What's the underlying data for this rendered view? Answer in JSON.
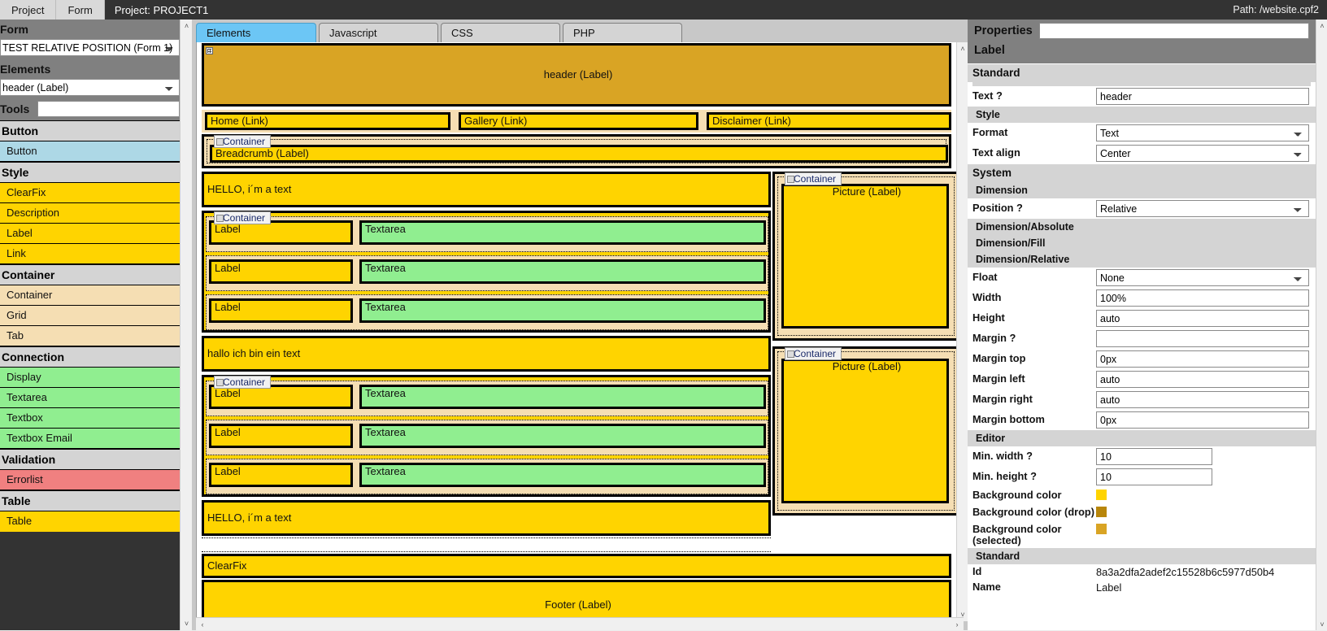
{
  "topbar": {
    "menu": [
      {
        "label": "Project",
        "active": false
      },
      {
        "label": "Form",
        "active": false
      }
    ],
    "project_tab": "Project: PROJECT1",
    "path": "Path: /website.cpf2"
  },
  "sidebar": {
    "form_heading": "Form",
    "form_select_value": "TEST RELATIVE POSITION (Form 1)",
    "elements_heading": "Elements",
    "elements_select_value": "header (Label)",
    "tools_heading": "Tools",
    "tools_input_value": "",
    "groups": [
      {
        "title": "Button",
        "color": "#add8e6",
        "items": [
          {
            "label": "Button"
          }
        ]
      },
      {
        "title": "Style",
        "color": "#ffd400",
        "items": [
          {
            "label": "ClearFix"
          },
          {
            "label": "Description"
          },
          {
            "label": "Label"
          },
          {
            "label": "Link"
          }
        ]
      },
      {
        "title": "Container",
        "color": "#f5deb3",
        "items": [
          {
            "label": "Container"
          },
          {
            "label": "Grid"
          },
          {
            "label": "Tab"
          }
        ]
      },
      {
        "title": "Connection",
        "color": "#90ee90",
        "items": [
          {
            "label": "Display"
          },
          {
            "label": "Textarea"
          },
          {
            "label": "Textbox"
          },
          {
            "label": "Textbox Email"
          }
        ]
      },
      {
        "title": "Validation",
        "color": "#f08080",
        "items": [
          {
            "label": "Errorlist"
          }
        ]
      },
      {
        "title": "Table",
        "color": "#ffd400",
        "items": [
          {
            "label": "Table"
          }
        ]
      }
    ]
  },
  "center": {
    "tabs": [
      {
        "label": "Elements",
        "selected": true
      },
      {
        "label": "Javascript",
        "selected": false
      },
      {
        "label": "CSS",
        "selected": false
      },
      {
        "label": "PHP",
        "selected": false
      }
    ],
    "canvas": {
      "header_label": "header (Label)",
      "nav_links": [
        "Home (Link)",
        "Gallery (Link)",
        "Disclaimer (Link)"
      ],
      "breadcrumb_container_tag": "Container",
      "breadcrumb_label": "Breadcrumb (Label)",
      "text_block_1": "HELLO, i´m a text",
      "form_container_tag": "Container",
      "rows_group_1": [
        {
          "label": "Label",
          "textarea": "Textarea"
        },
        {
          "label": "Label",
          "textarea": "Textarea"
        },
        {
          "label": "Label",
          "textarea": "Textarea"
        }
      ],
      "text_block_2": "hallo ich bin ein text",
      "rows_group_2": [
        {
          "label": "Label",
          "textarea": "Textarea"
        },
        {
          "label": "Label",
          "textarea": "Textarea"
        },
        {
          "label": "Label",
          "textarea": "Textarea"
        }
      ],
      "text_block_3": "HELLO, i´m a text",
      "clearfix_label": "ClearFix",
      "footer_label": "Footer (Label)",
      "picture_container_tag": "Container",
      "picture_label": "Picture (Label)",
      "picture_container_tag_2": "Container",
      "picture_label_2": "Picture (Label)"
    }
  },
  "properties": {
    "title": "Properties",
    "search_value": "",
    "element_type": "Label",
    "sections": {
      "standard_title": "Standard",
      "text_key": "Text",
      "text_value": "header",
      "style_title": "Style",
      "format_key": "Format",
      "format_value": "Text",
      "text_align_key": "Text align",
      "text_align_value": "Center",
      "system_title": "System",
      "dimension_title": "Dimension",
      "position_key": "Position",
      "position_value": "Relative",
      "dim_absolute_title": "Dimension/Absolute",
      "dim_fill_title": "Dimension/Fill",
      "dim_relative_title": "Dimension/Relative",
      "float_key": "Float",
      "float_value": "None",
      "width_key": "Width",
      "width_value": "100%",
      "height_key": "Height",
      "height_value": "auto",
      "margin_key": "Margin",
      "margin_value": "",
      "margin_top_key": "Margin top",
      "margin_top_value": "0px",
      "margin_left_key": "Margin left",
      "margin_left_value": "auto",
      "margin_right_key": "Margin right",
      "margin_right_value": "auto",
      "margin_bottom_key": "Margin bottom",
      "margin_bottom_value": "0px",
      "editor_title": "Editor",
      "min_width_key": "Min. width",
      "min_width_value": "10",
      "min_height_key": "Min. height",
      "min_height_value": "10",
      "bg_color_key": "Background color",
      "bg_color_value": "#ffd400",
      "bg_color_drop_key": "Background color (drop)",
      "bg_color_drop_value": "#b8860b",
      "bg_color_selected_key": "Background color (selected)",
      "bg_color_selected_value": "#d9a424",
      "standard2_title": "Standard",
      "id_key": "Id",
      "id_value": "8a3a2dfa2adef2c15528b6c5977d50b4",
      "name_key": "Name",
      "name_value": "Label"
    }
  },
  "icons": {
    "chevron_up": "˄",
    "chevron_down": "˅",
    "chevron_left": "‹",
    "chevron_right": "›"
  },
  "colors": {
    "gold": "#ffd400",
    "dark_gold": "#d9a424",
    "green": "#90ee90",
    "wheat": "#f5deb3",
    "blue_tab": "#6cc6f5",
    "red": "#f08080",
    "light_blue": "#add8e6"
  }
}
